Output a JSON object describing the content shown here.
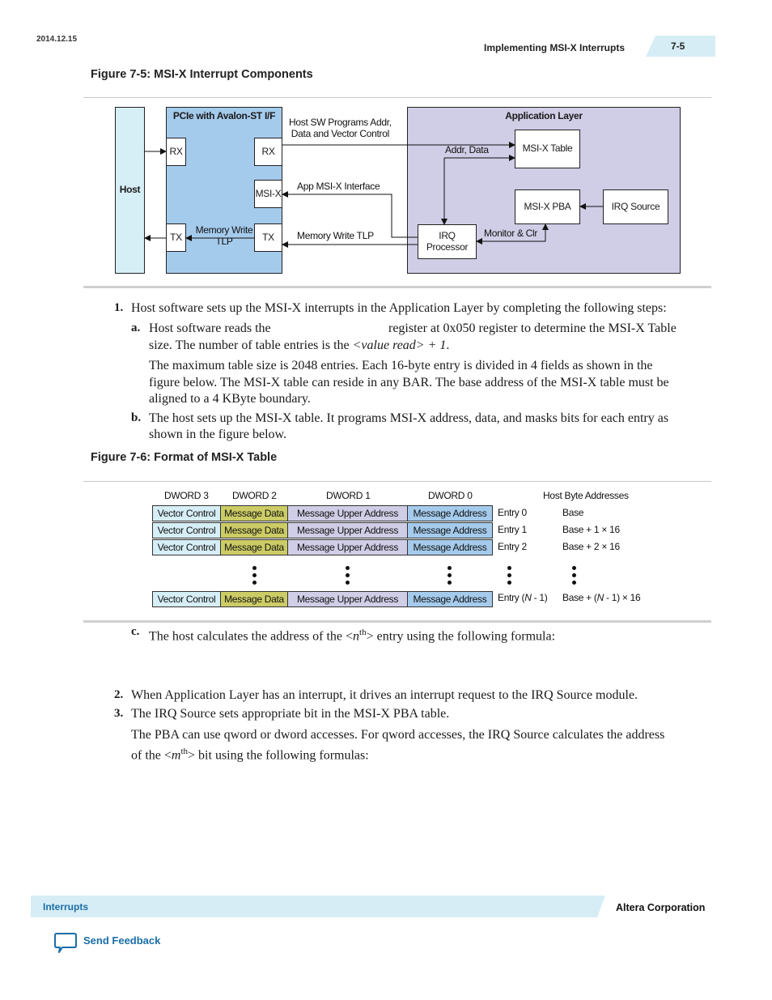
{
  "header": {
    "date": "2014.12.15",
    "section_title": "Implementing MSI-X Interrupts",
    "page_number": "7-5"
  },
  "figure1": {
    "title": "Figure 7-5: MSI-X Interrupt Components",
    "host_label": "Host",
    "pcie_label": "PCIe with Avalon-ST  I/F",
    "pcie_rx_left": "RX",
    "pcie_rx_right": "RX",
    "pcie_msix": "MSI-X",
    "pcie_tx_left": "TX",
    "pcie_tx_right": "TX",
    "internal_tlp_line1": "Memory Write",
    "internal_tlp_line2": "TLP",
    "host_sw_line1": "Host SW Programs Addr,",
    "host_sw_line2": "Data and Vector Control",
    "app_msix_interface": "App MSI-X Interface",
    "memory_write_tlp": "Memory Write TLP",
    "app_layer_label": "Application Layer",
    "msix_table": "MSI-X Table",
    "addr_data": "Addr, Data",
    "msix_pba": "MSI-X PBA",
    "irq_source": "IRQ Source",
    "irq_processor_line1": "IRQ",
    "irq_processor_line2": "Processor",
    "monitor_clr": "Monitor & Clr",
    "colors": {
      "host": "#d6eef6",
      "pcie": "#a5cbec",
      "app": "#d0cde6"
    }
  },
  "steps": {
    "s1_num": "1.",
    "s1_text": "Host software sets up the MSI-X interrupts in the Application Layer by completing the following steps:",
    "sa_num": "a.",
    "sa_text_part1": "Host software reads the",
    "sa_text_part2": "register at 0x050 register to determine the MSI-X Table",
    "sa_text_line2_pre": "size. The number of table entries is the ",
    "sa_text_line2_em": "<value read> + 1",
    "sa_text_line2_post": ".",
    "sa_para2_l1": "The maximum table size is 2048 entries. Each 16-byte entry is divided in 4 fields as shown in the",
    "sa_para2_l2": "figure below. The MSI-X table can reside in any BAR. The base address of the MSI-X table must be",
    "sa_para2_l3": "aligned to a 4 KByte boundary.",
    "sb_num": "b.",
    "sb_l1": "The host sets up the MSI-X table. It programs MSI-X address, data, and masks bits for each entry as",
    "sb_l2": "shown in the figure below.",
    "sc_num": "c.",
    "sc_pre": "The host calculates the address of the <",
    "sc_var": "n",
    "sc_sup": "th",
    "sc_post": "> entry using the following formula:",
    "s2_num": "2.",
    "s2_text": "When Application Layer has an interrupt, it drives an interrupt request to the IRQ Source module.",
    "s3_num": "3.",
    "s3_text": "The IRQ Source sets appropriate bit in the MSI-X PBA table.",
    "s3_para_l1": "The PBA can use qword or dword accesses. For qword accesses, the IRQ Source calculates the address",
    "s3_para_l2_pre": "of the <",
    "s3_para_l2_var": "m",
    "s3_para_l2_sup": "th",
    "s3_para_l2_post": "> bit using the following formulas:"
  },
  "figure2": {
    "title": "Figure 7-6: Format of MSI-X Table",
    "columns": [
      "DWORD 3",
      "DWORD 2",
      "DWORD 1",
      "DWORD 0"
    ],
    "address_header": "Host Byte Addresses",
    "rows": [
      {
        "cells": [
          "Vector Control",
          "Message Data",
          "Message Upper Address",
          "Message Address"
        ],
        "entry": "Entry 0",
        "address": "Base"
      },
      {
        "cells": [
          "Vector Control",
          "Message Data",
          "Message Upper Address",
          "Message Address"
        ],
        "entry": "Entry 1",
        "address": "Base + 1 × 16"
      },
      {
        "cells": [
          "Vector Control",
          "Message Data",
          "Message Upper Address",
          "Message Address"
        ],
        "entry": "Entry 2",
        "address": "Base + 2 × 16"
      }
    ],
    "last_row": {
      "cells": [
        "Vector Control",
        "Message Data",
        "Message Upper Address",
        "Message Address"
      ],
      "entry_pre": "Entry (",
      "entry_var": "N",
      "entry_post": " - 1)",
      "address_pre": "Base + (",
      "address_var": "N",
      "address_post": " - 1) × 16"
    },
    "colors": {
      "vector_control": "#d6eef6",
      "message_data": "#cccc66",
      "message_upper_address": "#d0cde6",
      "message_address": "#a5cbec"
    }
  },
  "footer": {
    "section": "Interrupts",
    "company": "Altera Corporation",
    "feedback": "Send Feedback"
  }
}
